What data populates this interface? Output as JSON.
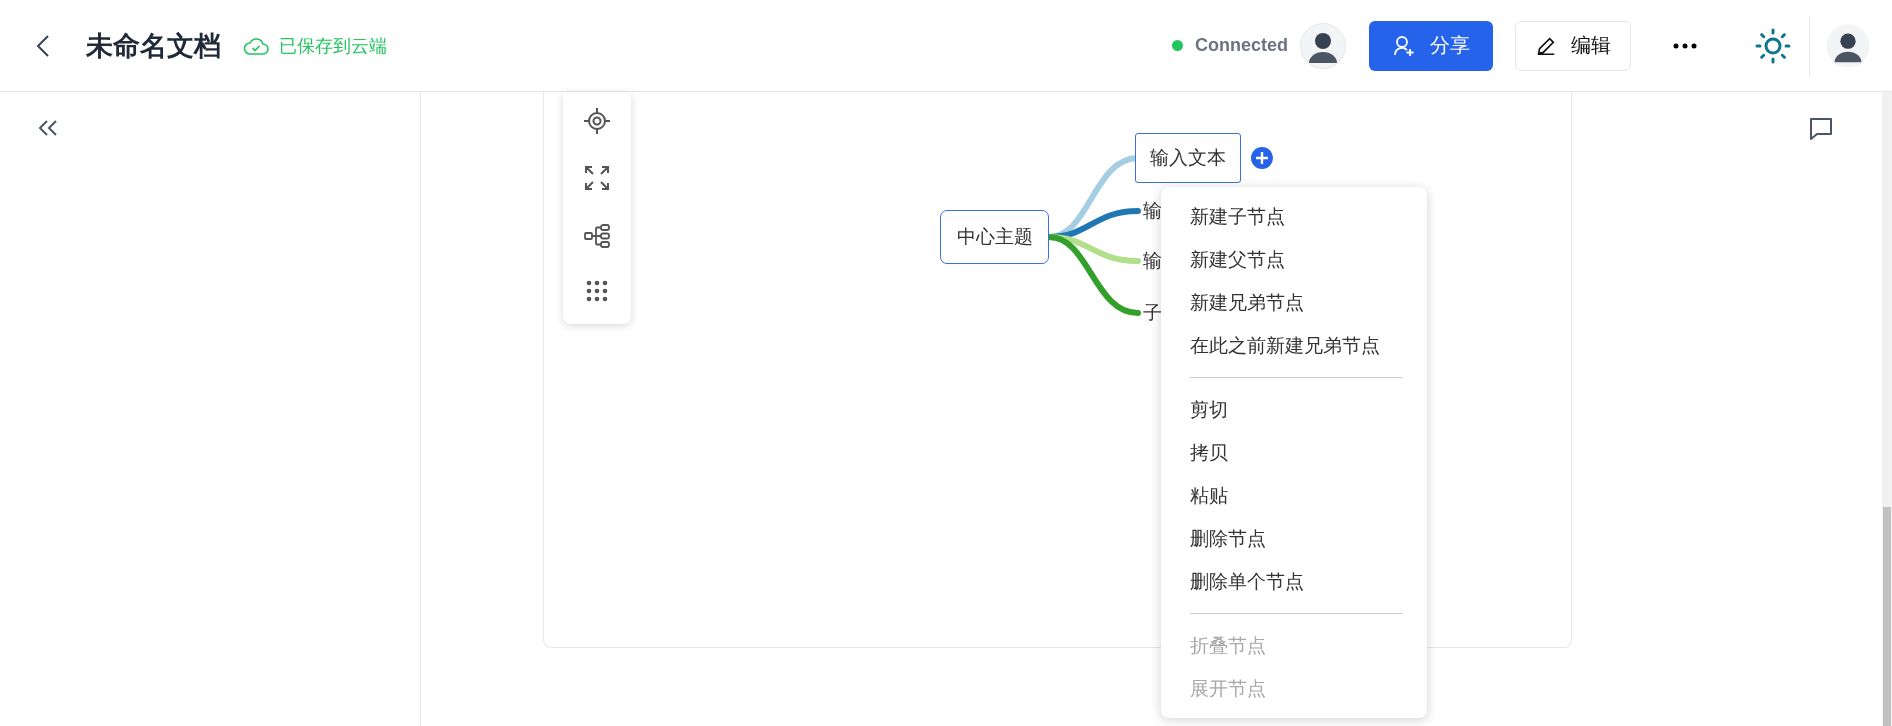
{
  "header": {
    "title": "未命名文档",
    "save_status": "已保存到云端",
    "connection": {
      "label": "Connected",
      "connected": true
    },
    "share_button": "分享",
    "edit_button": "编辑"
  },
  "mindmap": {
    "root": "中心主题",
    "children": [
      {
        "text": "输入文本",
        "selected": true,
        "color": "#a6cee3"
      },
      {
        "text": "输",
        "selected": false,
        "color": "#1f78b4"
      },
      {
        "text": "输",
        "selected": false,
        "color": "#b2df8a"
      },
      {
        "text": "子",
        "selected": false,
        "color": "#33a02c"
      }
    ]
  },
  "context_menu": {
    "groups": [
      [
        {
          "label": "新建子节点",
          "disabled": false
        },
        {
          "label": "新建父节点",
          "disabled": false
        },
        {
          "label": "新建兄弟节点",
          "disabled": false
        },
        {
          "label": "在此之前新建兄弟节点",
          "disabled": false
        }
      ],
      [
        {
          "label": "剪切",
          "disabled": false
        },
        {
          "label": "拷贝",
          "disabled": false
        },
        {
          "label": "粘贴",
          "disabled": false
        },
        {
          "label": "删除节点",
          "disabled": false
        },
        {
          "label": "删除单个节点",
          "disabled": false
        }
      ],
      [
        {
          "label": "折叠节点",
          "disabled": true
        },
        {
          "label": "展开节点",
          "disabled": true
        }
      ]
    ]
  }
}
